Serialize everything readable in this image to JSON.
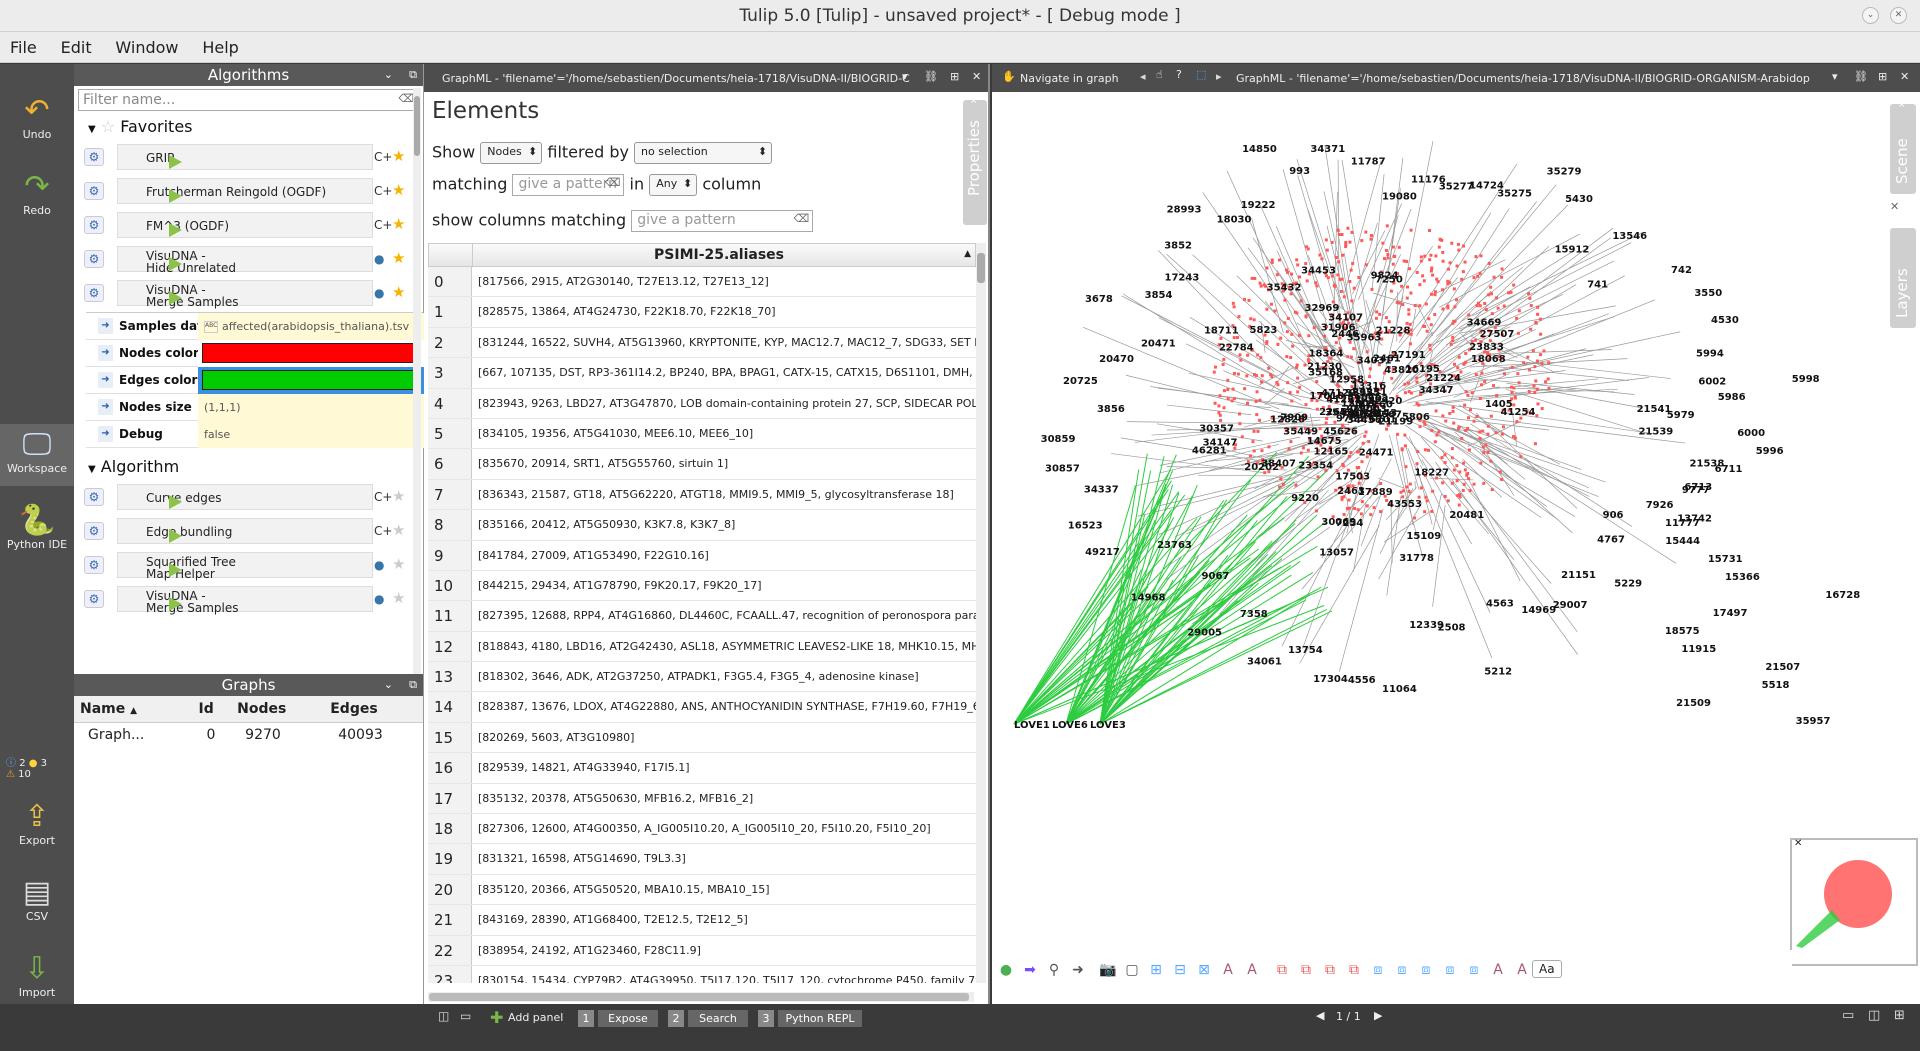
{
  "window": {
    "title": "Tulip 5.0 [Tulip] - unsaved project* - [ Debug mode ]"
  },
  "menu": [
    "File",
    "Edit",
    "Window",
    "Help"
  ],
  "leftbar": {
    "undo": "Undo",
    "redo": "Redo",
    "workspace": "Workspace",
    "python": "Python IDE",
    "export": "Export",
    "csv": "CSV",
    "import": "Import",
    "badges": {
      "info": "2",
      "python": "3",
      "warn": "10"
    }
  },
  "algorithms": {
    "title": "Algorithms",
    "filter_placeholder": "Filter name...",
    "favorites_label": "Favorites",
    "favorites": [
      {
        "name": "GRIP"
      },
      {
        "name": "Frutcherman Reingold (OGDF)"
      },
      {
        "name": "FM^3 (OGDF)"
      },
      {
        "name": "VisuDNA -",
        "name2": "Hide Unrelated"
      },
      {
        "name": "VisuDNA -",
        "name2": "Merge Samples"
      }
    ],
    "params": [
      {
        "label": "Samples data",
        "value": "affected(arabidopsis_thaliana).tsv"
      },
      {
        "label": "Nodes color",
        "value": "",
        "color": "#ff0000"
      },
      {
        "label": "Edges color",
        "value": "",
        "color": "#00cc00"
      },
      {
        "label": "Nodes size",
        "value": "(1,1,1)"
      },
      {
        "label": "Debug",
        "value": "false"
      }
    ],
    "algorithm_label": "Algorithm",
    "algorithm_items": [
      {
        "name": "Curve edges"
      },
      {
        "name": "Edge bundling"
      },
      {
        "name": "Squarified Tree",
        "name2": "Map Helper"
      },
      {
        "name": "VisuDNA -",
        "name2": "Merge Samples"
      }
    ]
  },
  "graphs": {
    "title": "Graphs",
    "columns": [
      "Name",
      "Id",
      "Nodes",
      "Edges"
    ],
    "rows": [
      {
        "name": "Graph...",
        "id": "0",
        "nodes": "9270",
        "edges": "40093"
      }
    ]
  },
  "elements": {
    "tab_title": "GraphML - 'filename'='/home/sebastien/Documents/heia-1718/VisuDNA-II/BIOGRID-C",
    "title": "Elements",
    "show_label": "Show",
    "show_value": "Nodes",
    "filtered_by_label": "filtered by",
    "filtered_by_value": "no selection",
    "matching_label": "matching",
    "pattern_placeholder": "give a pattern",
    "in_label": "in",
    "in_value": "Any",
    "column_label": "column",
    "show_columns_label": "show columns matching",
    "column_header": "PSIMI-25.aliases",
    "properties_tab": "Properties",
    "rows": [
      "[817566, 2915, AT2G30140, T27E13.12, T27E13_12]",
      "[828575, 13864, AT4G24730, F22K18.70, F22K18_70]",
      "[831244, 16522, SUVH4, AT5G13960, KRYPTONITE, KYP, MAC12.7, MAC12_7, SDG33, SET DO",
      "[667, 107135, DST, RP3-361I14.2, BP240, BPA, BPAG1, CATX-15, CATX15, D6S1101, DMH, DT",
      "[823943, 9263, LBD27, AT3G47870, LOB domain-containing protein 27, SCP, SIDECAR POLLEN",
      "[834105, 19356, AT5G41030, MEE6.10, MEE6_10]",
      "[835670, 20914, SRT1, AT5G55760, sirtuin 1]",
      "[836343, 21587, GT18, AT5G62220, ATGT18, MMI9.5, MMI9_5, glycosyltransferase 18]",
      "[835166, 20412, AT5G50930, K3K7.8, K3K7_8]",
      "[841784, 27009, AT1G53490, F22G10.16]",
      "[844215, 29434, AT1G78790, F9K20.17, F9K20_17]",
      "[827395, 12688, RPP4, AT4G16860, DL4460C, FCAALL.47, recognition of peronospora parasitic",
      "[818843, 4180, LBD16, AT2G42430, ASL18, ASYMMETRIC LEAVES2-LIKE 18, MHK10.15, MHK1",
      "[818302, 3646, ADK, AT2G37250, ATPADK1, F3G5.4, F3G5_4, adenosine kinase]",
      "[828387, 13676, LDOX, AT4G22880, ANS, ANTHOCYANIDIN SYNTHASE, F7H19.60, F7H19_6",
      "[820269, 5603, AT3G10980]",
      "[829539, 14821, AT4G33940, F17I5.1]",
      "[835132, 20378, AT5G50630, MFB16.2, MFB16_2]",
      "[827306, 12600, AT4G00350, A_IG005I10.20, A_IG005I10_20, F5I10.20, F5I10_20]",
      "[831321, 16598, AT5G14690, T9L3.3]",
      "[835120, 20366, AT5G50520, MBA10.15, MBA10_15]",
      "[843169, 28390, AT1G68400, T2E12.5, T2E12_5]",
      "[838954, 24192, AT1G23460, F28C11.9]",
      "[830154, 15434, CYP79B2, AT4G39950, T5J17.120, T5J17_120, cytochrome P450, family 79, s"
    ]
  },
  "graphview": {
    "nav_label": "Navigate in graph",
    "tab_title": "GraphML - 'filename'='/home/sebastien/Documents/heia-1718/VisuDNA-II/BIOGRID-ORGANISM-Arabidop",
    "scene_tab": "Scene",
    "layers_tab": "Layers",
    "page_indicator": "1 / 1",
    "font_button": "Aa",
    "node_labels": [
      "21541",
      "21539",
      "21538",
      "9777",
      "13742",
      "906",
      "4767",
      "5229",
      "21151",
      "29007",
      "14969",
      "4563",
      "5212",
      "2508",
      "12339",
      "11064",
      "4556",
      "17304",
      "13754",
      "34061",
      "7358",
      "29005",
      "9067",
      "14968",
      "23763",
      "49217",
      "16523",
      "34337",
      "30857",
      "30859",
      "3856",
      "20725",
      "20470",
      "20471",
      "3678",
      "3854",
      "17243",
      "3852",
      "28993",
      "18030",
      "19222",
      "14850",
      "993",
      "34371",
      "11787",
      "19080",
      "11176",
      "35277",
      "14724",
      "35275",
      "35279",
      "5430",
      "15912",
      "13546",
      "741",
      "742",
      "3550",
      "4530",
      "5994",
      "6002",
      "5998",
      "5986",
      "5979",
      "6000",
      "5996",
      "6711",
      "6713",
      "7926",
      "11777",
      "15444",
      "15731",
      "15366",
      "16728",
      "17497",
      "18575",
      "11915",
      "21507",
      "5518",
      "21509",
      "35957",
      "35963",
      "35955",
      "36075",
      "41257",
      "41254",
      "45626",
      "34347",
      "35449",
      "35432",
      "27507",
      "34031",
      "12958",
      "23354",
      "34453",
      "27191",
      "30069",
      "35435",
      "9785",
      "9790",
      "22784",
      "7911",
      "7909",
      "9824",
      "32969",
      "18227",
      "18068",
      "47129",
      "2461",
      "2463",
      "34107",
      "12303",
      "14675",
      "17018",
      "18711",
      "13057",
      "17503",
      "34147",
      "7254",
      "7250",
      "17889",
      "23231",
      "12165",
      "1405",
      "13316",
      "22650",
      "30357",
      "6627",
      "2446",
      "6701",
      "20473",
      "24471",
      "29003",
      "3001",
      "21199",
      "34456",
      "LOVE1",
      "LOVE6",
      "LOVE3",
      "20202",
      "20481",
      "15109",
      "12826",
      "10902",
      "17160",
      "35168",
      "13143",
      "23833",
      "32920",
      "20667",
      "9220",
      "21230",
      "43820",
      "46281",
      "31778",
      "18364",
      "38407",
      "34669",
      "43553",
      "16195",
      "21228",
      "21224",
      "31906",
      "5806",
      "5823"
    ]
  },
  "bottombar": {
    "add_panel": "Add panel",
    "tabs": [
      {
        "num": "1",
        "label": "Expose"
      },
      {
        "num": "2",
        "label": "Search"
      },
      {
        "num": "3",
        "label": "Python REPL"
      }
    ]
  }
}
